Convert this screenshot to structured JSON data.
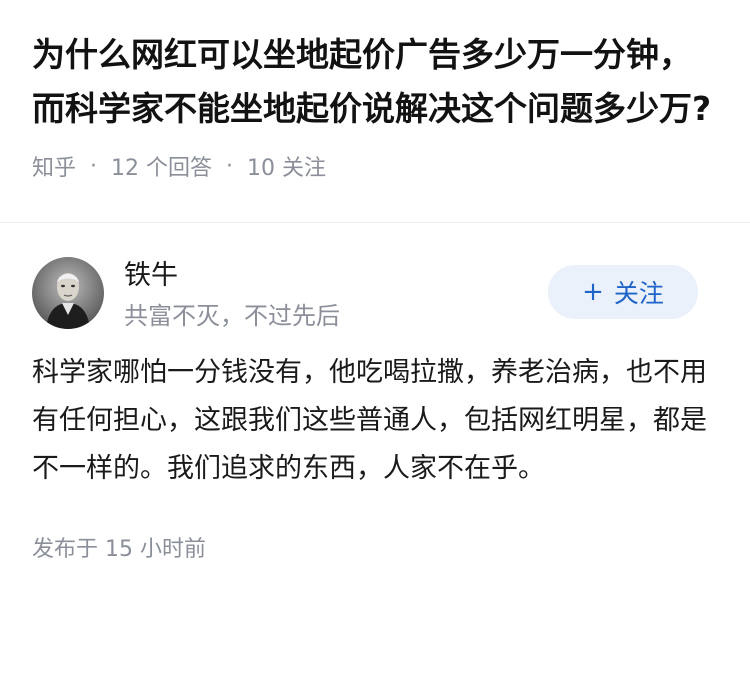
{
  "question": {
    "title": "为什么网红可以坐地起价广告多少万一分钟，而科学家不能坐地起价说解决这个问题多少万?",
    "source": "知乎",
    "separator": "·",
    "answer_count": "12 个回答",
    "follower_count": "10 关注"
  },
  "answer": {
    "author": {
      "name": "铁牛",
      "bio": "共富不灭，不过先后",
      "avatar_icon": "portrait-avatar"
    },
    "follow_button": {
      "icon": "plus-icon",
      "plus": "+",
      "label": "关注"
    },
    "content": "科学家哪怕一分钱没有，他吃喝拉撒，养老治病，也不用有任何担心，这跟我们这些普通人，包括网红明星，都是不一样的。我们追求的东西，人家不在乎。",
    "published": "发布于 15 小时前"
  },
  "colors": {
    "meta_gray": "#8a8f99",
    "accent_blue": "#1f64c8",
    "button_bg": "#eaf1fb"
  }
}
